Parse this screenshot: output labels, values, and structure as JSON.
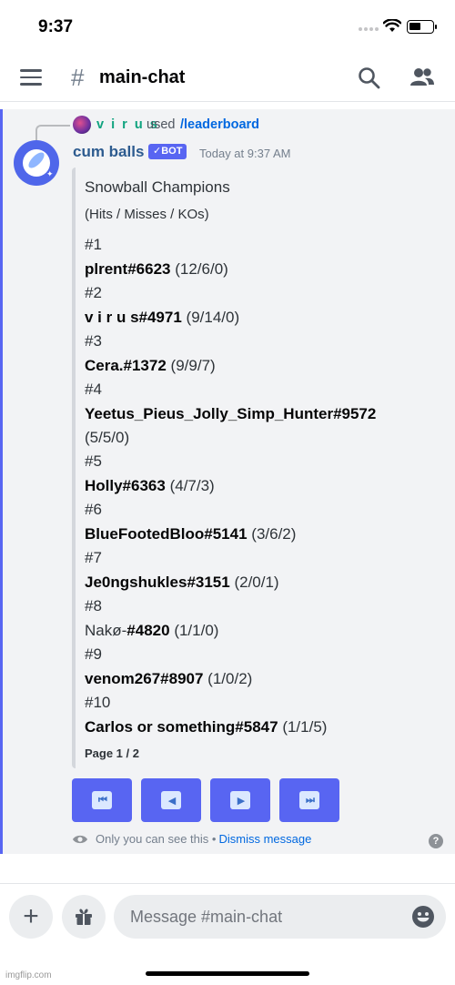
{
  "status_bar": {
    "time": "9:37"
  },
  "header": {
    "hash": "#",
    "channel": "main-chat"
  },
  "reply": {
    "user": "v i r u s",
    "used": "used",
    "command": "/leaderboard"
  },
  "message": {
    "author": "cum balls",
    "bot_tag": "✓BOT",
    "timestamp": "Today at 9:37 AM"
  },
  "embed": {
    "title": "Snowball Champions",
    "subtitle": "(Hits / Misses / KOs)",
    "entries": [
      {
        "rank": "#1",
        "name": "plrent#6623",
        "stats": "(12/6/0)"
      },
      {
        "rank": "#2",
        "name": "v i r u s#4971",
        "stats": "(9/14/0)"
      },
      {
        "rank": "#3",
        "name": "Cera.#1372",
        "stats": "(9/9/7)"
      },
      {
        "rank": "#4",
        "name": "Yeetus_Pieus_Jolly_Simp_Hunter#9572",
        "stats": "(5/5/0)"
      },
      {
        "rank": "#5",
        "name": "Holly#6363",
        "stats": "(4/7/3)"
      },
      {
        "rank": "#6",
        "name": "BlueFootedBloo#5141",
        "stats": "(3/6/2)"
      },
      {
        "rank": "#7",
        "name": "Je0ngshukles#3151",
        "stats": "(2/0/1)"
      },
      {
        "rank": "#8",
        "name_plain": "Nakø",
        "name": "#4820",
        "stats": "(1/1/0)"
      },
      {
        "rank": "#9",
        "name": "venom267#8907",
        "stats": "(1/0/2)"
      },
      {
        "rank": "#10",
        "name": "Carlos or something#5847",
        "stats": "(1/1/5)"
      }
    ],
    "page": "Page 1 / 2"
  },
  "buttons": {
    "first": "⏮",
    "prev": "◀",
    "next": "▶",
    "last": "⏭"
  },
  "ephemeral": {
    "note": "Only you can see this",
    "sep": "•",
    "dismiss": "Dismiss message"
  },
  "composer": {
    "placeholder": "Message #main-chat"
  },
  "watermark": "imgflip.com"
}
